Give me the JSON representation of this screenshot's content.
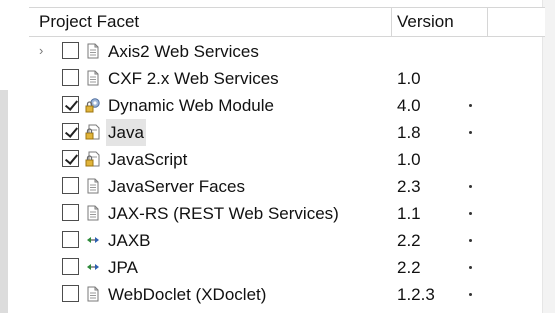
{
  "header": {
    "facet_label": "Project Facet",
    "version_label": "Version"
  },
  "rows": [
    {
      "name": "Axis2 Web Services",
      "version": "",
      "checked": false,
      "icon": "page-icon",
      "expander": true,
      "dropdown": false
    },
    {
      "name": "CXF 2.x Web Services",
      "version": "1.0",
      "checked": false,
      "icon": "page-icon",
      "expander": false,
      "dropdown": false
    },
    {
      "name": "Dynamic Web Module",
      "version": "4.0",
      "checked": true,
      "icon": "locked-gear-icon",
      "expander": false,
      "dropdown": true
    },
    {
      "name": "Java",
      "version": "1.8",
      "checked": true,
      "icon": "locked-page-icon",
      "expander": false,
      "dropdown": true,
      "selected": true
    },
    {
      "name": "JavaScript",
      "version": "1.0",
      "checked": true,
      "icon": "locked-page-icon",
      "expander": false,
      "dropdown": false
    },
    {
      "name": "JavaServer Faces",
      "version": "2.3",
      "checked": false,
      "icon": "page-icon",
      "expander": false,
      "dropdown": true
    },
    {
      "name": "JAX-RS (REST Web Services)",
      "version": "1.1",
      "checked": false,
      "icon": "page-icon",
      "expander": false,
      "dropdown": true
    },
    {
      "name": "JAXB",
      "version": "2.2",
      "checked": false,
      "icon": "arrows-icon",
      "expander": false,
      "dropdown": true
    },
    {
      "name": "JPA",
      "version": "2.2",
      "checked": false,
      "icon": "arrows-icon",
      "expander": false,
      "dropdown": true
    },
    {
      "name": "WebDoclet (XDoclet)",
      "version": "1.2.3",
      "checked": false,
      "icon": "page-icon",
      "expander": false,
      "dropdown": true
    }
  ]
}
